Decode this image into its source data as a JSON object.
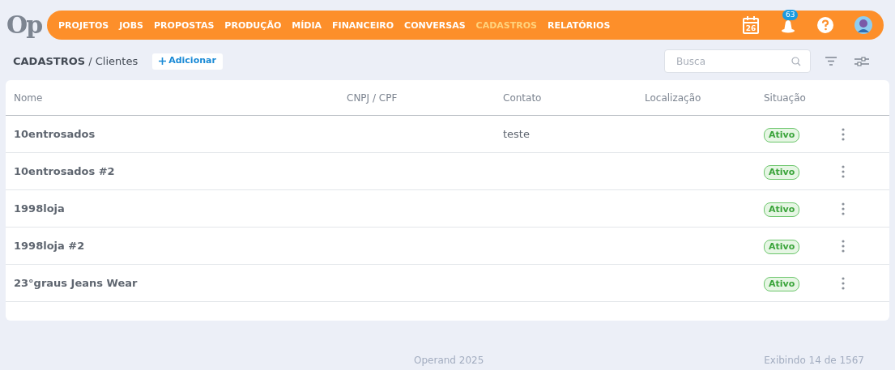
{
  "logo": "Op",
  "nav": [
    {
      "label": "PROJETOS",
      "selected": false
    },
    {
      "label": "JOBS",
      "selected": false
    },
    {
      "label": "PROPOSTAS",
      "selected": false
    },
    {
      "label": "PRODUÇÃO",
      "selected": false
    },
    {
      "label": "MÍDIA",
      "selected": false
    },
    {
      "label": "FINANCEIRO",
      "selected": false
    },
    {
      "label": "CONVERSAS",
      "selected": false
    },
    {
      "label": "CADASTROS",
      "selected": true
    },
    {
      "label": "RELATÓRIOS",
      "selected": false
    }
  ],
  "header_icons": {
    "calendar_day": "26",
    "notification_count": "63"
  },
  "breadcrumb": {
    "section": "CADASTROS",
    "separator": "/",
    "page": "Clientes"
  },
  "add_button": "Adicionar",
  "search": {
    "placeholder": "Busca"
  },
  "table": {
    "columns": [
      "Nome",
      "CNPJ / CPF",
      "Contato",
      "Localização",
      "Situação"
    ],
    "rows": [
      {
        "name": "10entrosados",
        "contact": "teste",
        "status": "Ativo"
      },
      {
        "name": "10entrosados #2",
        "status": "Ativo"
      },
      {
        "name": "1998loja",
        "status": "Ativo"
      },
      {
        "name": "1998loja #2",
        "status": "Ativo"
      },
      {
        "name": "23°graus Jeans Wear",
        "status": "Ativo"
      }
    ]
  },
  "footer": {
    "copyright": "Operand 2025",
    "count": "Exibindo 14 de 1567"
  }
}
